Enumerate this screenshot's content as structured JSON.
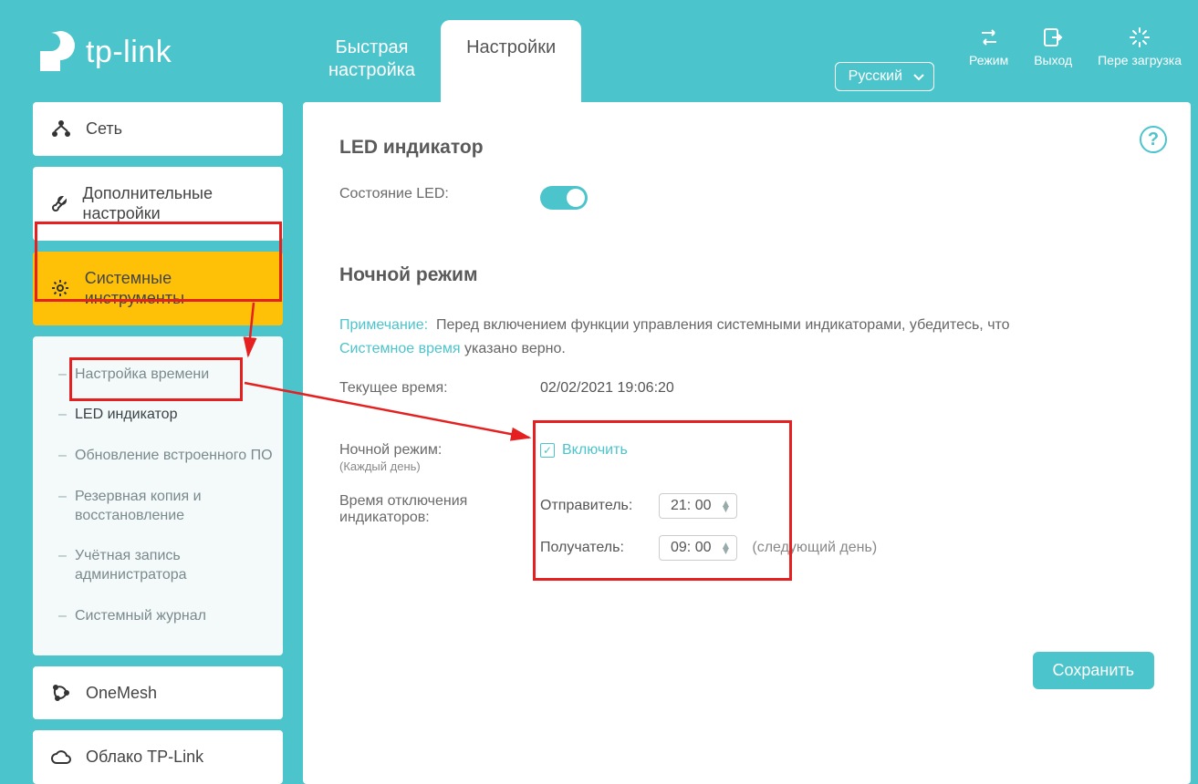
{
  "brand": "tp-link",
  "tabs": {
    "quick_setup": "Быстрая\nнастройка",
    "settings": "Настройки"
  },
  "top": {
    "language": "Русский",
    "mode": "Режим",
    "logout": "Выход",
    "reboot": "Пере загрузка"
  },
  "sidebar": {
    "network": "Сеть",
    "advanced": "Дополнительные настройки",
    "system_tools": "Системные инструменты",
    "submenu": {
      "time_settings": "Настройка времени",
      "led_control": "LED индикатор",
      "firmware": "Обновление встроенного ПО",
      "backup": "Резервная копия и восстановление",
      "admin": "Учётная запись администратора",
      "syslog": "Системный журнал"
    },
    "onemesh": "OneMesh",
    "cloud": "Облако TP-Link"
  },
  "content": {
    "section_led": "LED индикатор",
    "led_state_label": "Состояние LED:",
    "section_night": "Ночной режим",
    "note_label": "Примечание:",
    "note_text_before": "Перед включением функции управления системными индикаторами, убедитесь, что",
    "note_link": "Системное время",
    "note_text_after": "указано верно.",
    "current_time_label": "Текущее время:",
    "current_time_value": "02/02/2021 19:06:20",
    "night_mode_label": "Ночной режим:",
    "night_mode_sub": "(Каждый день)",
    "enable_label": "Включить",
    "led_off_label": "Время отключения индикаторов:",
    "from_label": "Отправитель:",
    "from_value": "21: 00",
    "to_label": "Получатель:",
    "to_value": "09: 00",
    "next_day": "(следующий день)",
    "save": "Сохранить"
  }
}
